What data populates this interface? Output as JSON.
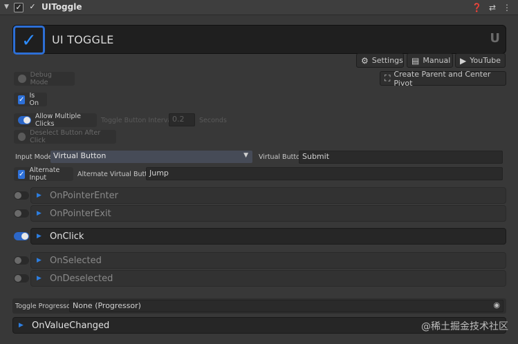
{
  "header": {
    "title": "UIToggle",
    "fold_icon": "triangle-down-icon",
    "icons": [
      "help-icon",
      "sliders-icon",
      "more-vert-icon"
    ]
  },
  "banner": {
    "title": "UI TOGGLE",
    "logo_glyph": "✓",
    "brand_glyph": "U"
  },
  "toolbar": {
    "settings": "Settings",
    "manual": "Manual",
    "youtube": "YouTube",
    "create_parent": "Create Parent and Center Pivot"
  },
  "options": {
    "debug_mode": "Debug Mode",
    "is_on": "Is On",
    "allow_multiple_clicks": "Allow Multiple Clicks",
    "toggle_interval_label": "Toggle Button Interval",
    "toggle_interval_value": "0.2",
    "seconds": "Seconds",
    "deselect_after_click": "Deselect Button After Click"
  },
  "input": {
    "mode_label": "Input Mode",
    "mode_value": "Virtual Button",
    "vbutton_label": "Virtual Button",
    "vbutton_value": "Submit",
    "alt_input_label": "Alternate Input",
    "alt_vbutton_label": "Alternate Virtual Button",
    "alt_vbutton_value": "Jump"
  },
  "events": [
    {
      "name": "OnPointerEnter",
      "enabled": false
    },
    {
      "name": "OnPointerExit",
      "enabled": false
    },
    {
      "name": "OnClick",
      "enabled": true
    },
    {
      "name": "OnSelected",
      "enabled": false
    },
    {
      "name": "OnDeselected",
      "enabled": false
    }
  ],
  "progressor": {
    "label": "Toggle Progressor",
    "value": "None (Progressor)"
  },
  "on_value_changed": "OnValueChanged",
  "watermark": "@稀土掘金技术社区",
  "colors": {
    "accent": "#2d70d8",
    "background": "#383838"
  }
}
